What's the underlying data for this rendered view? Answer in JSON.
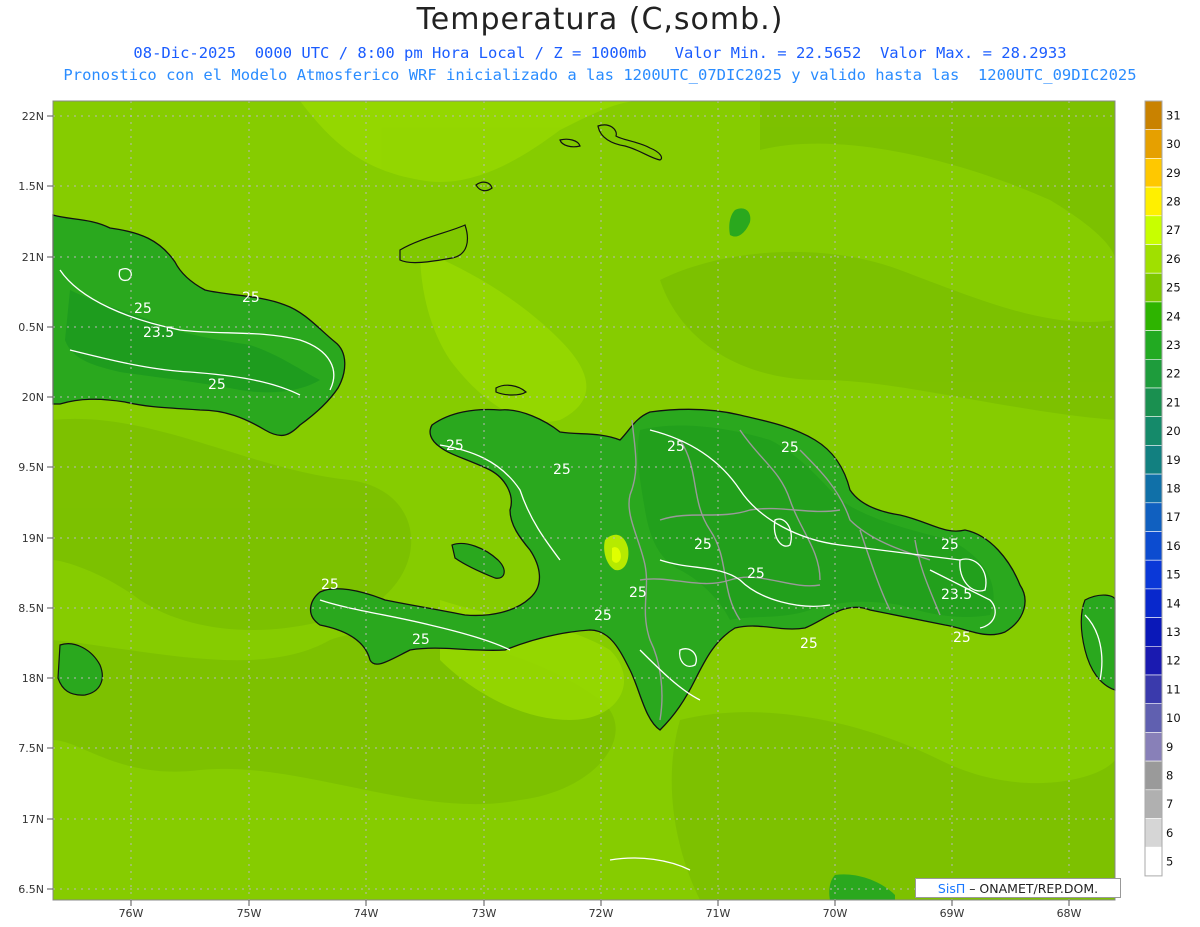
{
  "header": {
    "title": "Temperatura (C,somb.)",
    "line1": "08-Dic-2025  0000 UTC / 8:00 pm Hora Local / Z = 1000mb   Valor Min. = 22.5652  Valor Max. = 28.2933",
    "line2": "Pronostico con el Modelo Atmosferico WRF inicializado a las 1200UTC_07DIC2025 y valido hasta las  1200UTC_09DIC2025"
  },
  "axes": {
    "lon_labels": [
      "76W",
      "75W",
      "74W",
      "73W",
      "72W",
      "71W",
      "70W",
      "69W",
      "68W"
    ],
    "lat_labels": [
      "22N",
      "1.5N",
      "21N",
      "0.5N",
      "20N",
      "9.5N",
      "19N",
      "8.5N",
      "18N",
      "7.5N",
      "17N",
      "6.5N"
    ]
  },
  "colorbar": {
    "levels": [
      "31",
      "30",
      "29",
      "28",
      "27",
      "26",
      "25",
      "24",
      "23",
      "22",
      "21",
      "20",
      "19",
      "18",
      "17",
      "16",
      "15",
      "14",
      "13",
      "12",
      "11",
      "10",
      "9",
      "8",
      "7",
      "6",
      "5"
    ],
    "colors": [
      "#c98200",
      "#e6a000",
      "#ffc800",
      "#fff000",
      "#c8ff00",
      "#a0e000",
      "#7ec800",
      "#2eb400",
      "#22aa22",
      "#1e9c3c",
      "#1a9050",
      "#158a6a",
      "#128080",
      "#1070a8",
      "#1060c0",
      "#0c4cd0",
      "#0a38d8",
      "#0828cc",
      "#0a18b8",
      "#1a1ab0",
      "#3a3aac",
      "#6060b0",
      "#8880b8",
      "#9a9a9a",
      "#b0b0b0",
      "#d6d6d6",
      "#ffffff"
    ]
  },
  "contour_labels": [
    "25",
    "25",
    "23.5",
    "25",
    "25",
    "25",
    "25",
    "25",
    "25",
    "25",
    "25",
    "25",
    "25",
    "25",
    "23.5",
    "25",
    "25"
  ],
  "credit": {
    "brand": "SisΠ",
    "text": " – ONAMET/REP.DOM."
  }
}
